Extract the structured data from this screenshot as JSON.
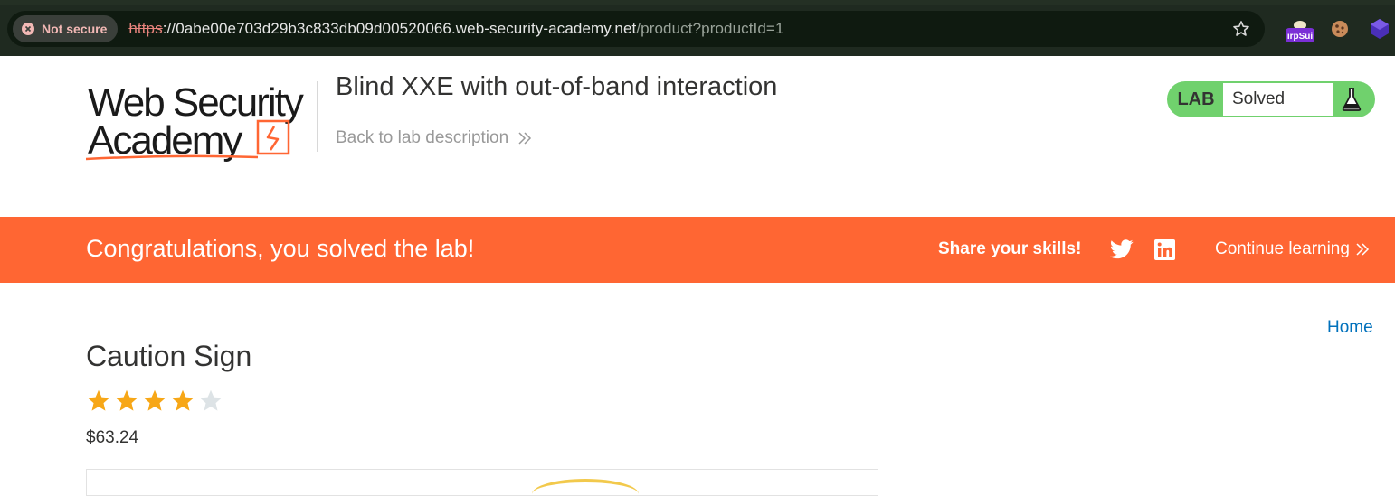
{
  "browser": {
    "security_label": "Not secure",
    "url_scheme": "https",
    "url_host": "://0abe00e703d29b3c833db09d00520066.web-security-academy.net",
    "url_path": "/product?productId=1",
    "extensions": [
      "burp-suite-icon",
      "cookie-icon",
      "cube-icon"
    ],
    "burp_badge": "ırpSui"
  },
  "lab_header": {
    "logo_line1": "Web Security",
    "logo_line2": "Academy",
    "title": "Blind XXE with out-of-band interaction",
    "back_link": "Back to lab description",
    "status_label": "LAB",
    "status_value": "Solved"
  },
  "banner": {
    "message": "Congratulations, you solved the lab!",
    "share_label": "Share your skills!",
    "continue_label": "Continue learning"
  },
  "product": {
    "home_link": "Home",
    "title": "Caution Sign",
    "rating": 4,
    "rating_max": 5,
    "price": "$63.24"
  },
  "colors": {
    "brand_orange": "#ff6633",
    "status_green": "#70d16d",
    "link_blue": "#0071bc",
    "star_filled": "#f7a717",
    "star_empty": "#dde3e6"
  }
}
